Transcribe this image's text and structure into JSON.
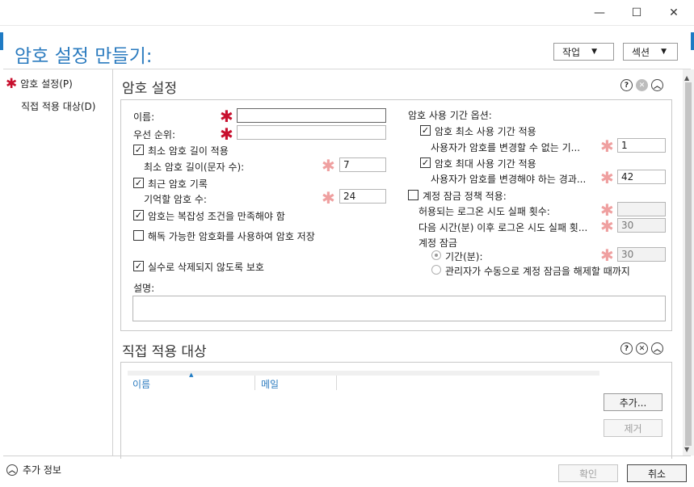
{
  "window": {
    "minimize": "—",
    "maximize": "☐",
    "close": "✕"
  },
  "header": {
    "title": "암호 설정 만들기:",
    "tasks_label": "작업",
    "sections_label": "섹션"
  },
  "nav": {
    "items": [
      {
        "label": "암호 설정(P)",
        "required": true
      },
      {
        "label": "직접 적용 대상(D)",
        "required": false
      }
    ]
  },
  "password_settings": {
    "title": "암호 설정",
    "name_label": "이름:",
    "name_value": "",
    "precedence_label": "우선 순위:",
    "precedence_value": "",
    "min_length": {
      "label": "최소 암호 길이 적용",
      "checked": true,
      "sub_label": "최소 암호 길이(문자 수):",
      "value": "7"
    },
    "history": {
      "label": "최근 암호 기록",
      "checked": true,
      "sub_label": "기억할 암호 수:",
      "value": "24"
    },
    "complexity": {
      "label": "암호는 복잡성 조건을 만족해야 함",
      "checked": true
    },
    "reversible": {
      "label": "해독 가능한 암호화를 사용하여 암호 저장",
      "checked": false
    },
    "protect_delete": {
      "label": "실수로 삭제되지 않도록 보호",
      "checked": true
    },
    "description_label": "설명:",
    "description_value": "",
    "age_options_label": "암호 사용 기간 옵션:",
    "min_age": {
      "label": "암호 최소 사용 기간 적용",
      "checked": true,
      "sub_label": "사용자가 암호를 변경할 수 없는 기...",
      "value": "1"
    },
    "max_age": {
      "label": "암호 최대 사용 기간 적용",
      "checked": true,
      "sub_label": "사용자가 암호를 변경해야 하는 경과...",
      "value": "42"
    },
    "lockout": {
      "label": "계정 잠금 정책 적용:",
      "checked": false,
      "attempts_label": "허용되는 로그온 시도 실패 횟수:",
      "attempts_value": "",
      "reset_label": "다음 시간(분) 이후 로그온 시도 실패 횟...",
      "reset_value": "30",
      "lock_label": "계정 잠금",
      "duration_label": "기간(분):",
      "duration_value": "30",
      "manual_label": "관리자가 수동으로 계정 잠금을 해제할 때까지"
    }
  },
  "directly_applies": {
    "title": "직접 적용 대상",
    "columns": [
      "이름",
      "메일"
    ],
    "add_label": "추가...",
    "remove_label": "제거"
  },
  "footer": {
    "more_info_label": "추가 정보",
    "ok_label": "확인",
    "cancel_label": "취소"
  }
}
